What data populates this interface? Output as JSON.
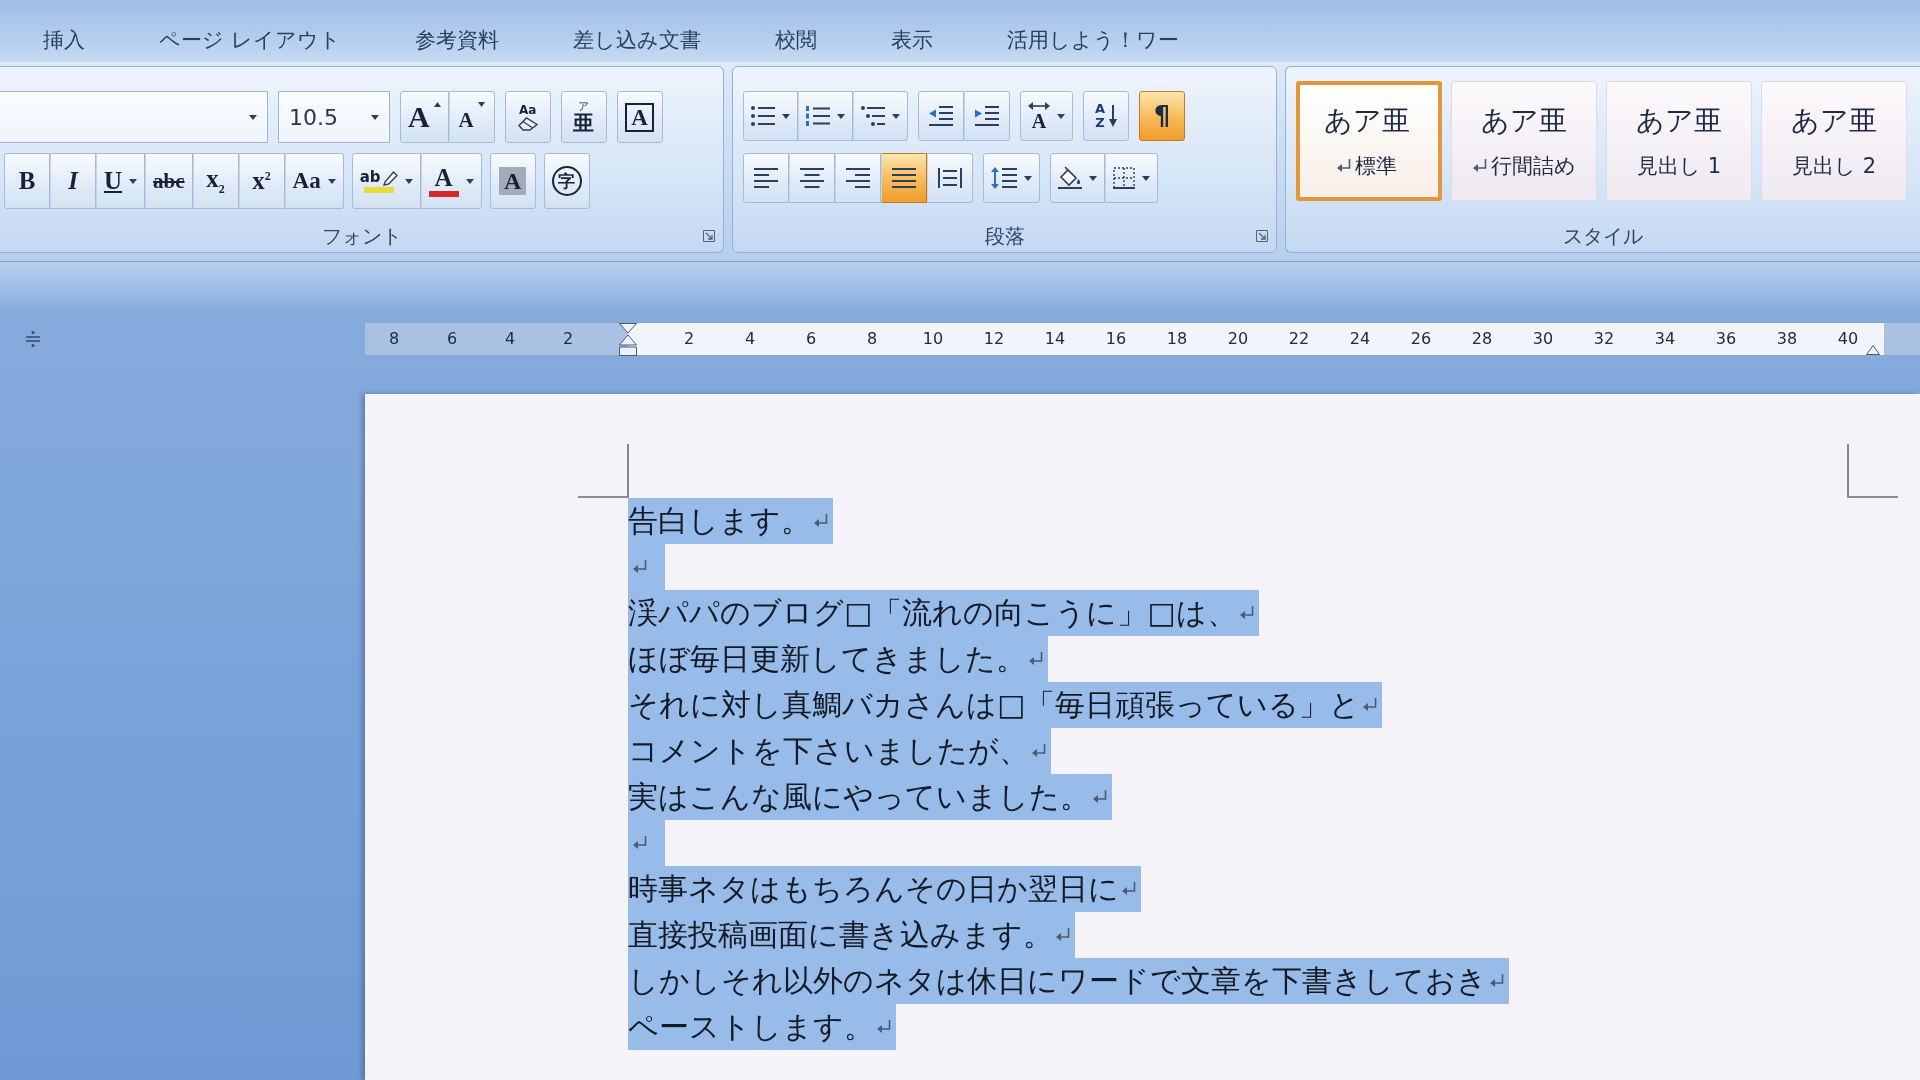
{
  "tabs": [
    {
      "label": "挿入",
      "selected": false
    },
    {
      "label": "ページ レイアウト",
      "selected": false
    },
    {
      "label": "参考資料",
      "selected": false
    },
    {
      "label": "差し込み文書",
      "selected": false
    },
    {
      "label": "校閲",
      "selected": false
    },
    {
      "label": "表示",
      "selected": false
    },
    {
      "label": "活用しよう！ワー",
      "selected": false
    }
  ],
  "font_group": {
    "label": "フォント",
    "font_size": "10.5",
    "dialog_launcher": true,
    "row_1": [
      {
        "kind": "grow_font",
        "glyph": "A"
      },
      {
        "kind": "shrink_font",
        "glyph": "A"
      },
      {
        "kind": "clear_formatting",
        "glyph": "Aa"
      },
      {
        "kind": "phonetic_guide",
        "glyph": "亜",
        "ruby": "ア"
      },
      {
        "kind": "character_border",
        "glyph": "A"
      }
    ],
    "row_2": [
      {
        "kind": "bold",
        "glyph": "B"
      },
      {
        "kind": "italic",
        "glyph": "I"
      },
      {
        "kind": "underline",
        "glyph": "U",
        "dropdown": true
      },
      {
        "kind": "strikethrough",
        "glyph": "abc"
      },
      {
        "kind": "subscript",
        "glyph": "x$_{2}$"
      },
      {
        "kind": "superscript",
        "glyph": "x$^{2}$"
      },
      {
        "kind": "change_case",
        "glyph": "Aa",
        "dropdown": true
      },
      {
        "kind": "highlight",
        "glyph": "ab",
        "color": "#e8dc3c",
        "dropdown": true
      },
      {
        "kind": "font_color",
        "glyph": "A",
        "color": "#d22a2a",
        "dropdown": true
      },
      {
        "kind": "character_shading",
        "glyph": "A"
      },
      {
        "kind": "enclosed_character",
        "glyph": "字"
      }
    ]
  },
  "paragraph_group": {
    "label": "段落",
    "dialog_launcher": true,
    "row_1": [
      {
        "kind": "bullets",
        "dropdown": true,
        "on": false
      },
      {
        "kind": "numbering",
        "dropdown": true,
        "on": false
      },
      {
        "kind": "multilevel_list",
        "dropdown": true,
        "on": false
      },
      {
        "kind": "decrease_indent",
        "on": false
      },
      {
        "kind": "increase_indent",
        "on": false
      },
      {
        "kind": "asian_layout",
        "glyph": "A",
        "dropdown": true,
        "on": false
      },
      {
        "kind": "sort",
        "glyph": "A",
        "glyph_lower": "Z",
        "on": false
      },
      {
        "kind": "show_marks",
        "glyph": "¶",
        "on": true
      }
    ],
    "row_2": [
      {
        "kind": "align_left",
        "on": false
      },
      {
        "kind": "align_center",
        "on": false
      },
      {
        "kind": "align_right",
        "on": false
      },
      {
        "kind": "justify",
        "on": true
      },
      {
        "kind": "distributed",
        "on": false
      },
      {
        "kind": "line_spacing",
        "dropdown": true,
        "on": false
      },
      {
        "kind": "shading",
        "dropdown": true,
        "on": false
      },
      {
        "kind": "borders",
        "dropdown": true,
        "on": false
      }
    ]
  },
  "styles_group": {
    "label": "スタイル",
    "styles": [
      {
        "preview": "あア亜",
        "name": "標準",
        "kind": "paragraph",
        "selected": true
      },
      {
        "preview": "あア亜",
        "name": "行間詰め",
        "kind": "paragraph",
        "selected": false
      },
      {
        "preview": "あア亜",
        "name": "見出し 1",
        "kind": "linked",
        "selected": false
      },
      {
        "preview": "あア亜",
        "name": "見出し 2",
        "kind": "linked",
        "selected": false
      }
    ]
  },
  "ruler": {
    "left_ticks": [
      "8",
      "6",
      "4",
      "2"
    ],
    "right_ticks": [
      "2",
      "4",
      "6",
      "8",
      "10",
      "12",
      "14",
      "16",
      "18",
      "20",
      "22",
      "24",
      "26",
      "28",
      "30",
      "32",
      "34",
      "36",
      "38",
      "40"
    ]
  },
  "document": {
    "lines": [
      {
        "text": "告白します。",
        "selected": true
      },
      {
        "selected": true
      },
      {
        "text": "渓パパのブログ□「流れの向こうに」□は、",
        "selected": true
      },
      {
        "text": "ほぼ毎日更新してきました。",
        "selected": true
      },
      {
        "text": "それに対し真鯛バカさんは□「毎日頑張っている」と",
        "selected": true
      },
      {
        "text": "コメントを下さいましたが、",
        "selected": true
      },
      {
        "text": "実はこんな風にやっていました。",
        "selected": true
      },
      {
        "selected": true
      },
      {
        "text": "時事ネタはもちろんその日か翌日に",
        "selected": true
      },
      {
        "text": "直接投稿画面に書き込みます。",
        "selected": true
      },
      {
        "text": "しかしそれ以外のネタは休日にワードで文章を下書きしておき",
        "selected": true
      },
      {
        "text": "ペーストします。",
        "selected": true
      }
    ]
  }
}
